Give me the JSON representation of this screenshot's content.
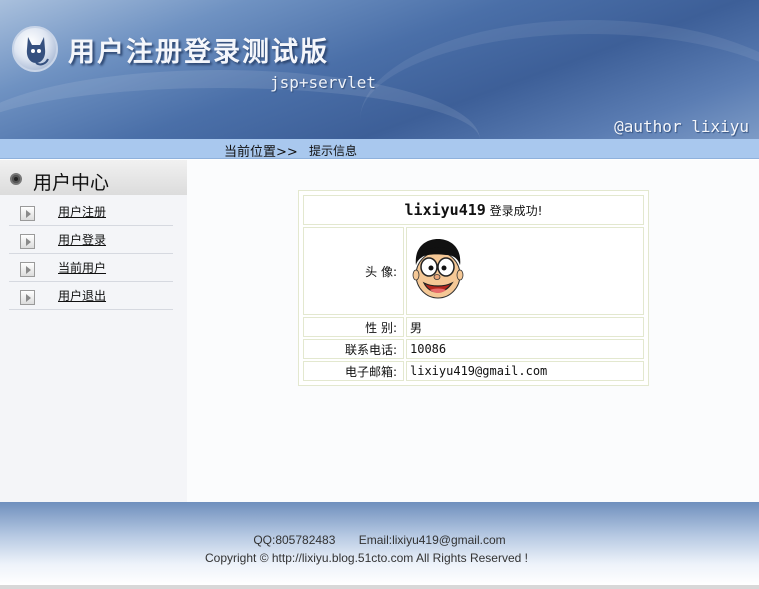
{
  "header": {
    "title": "用户注册登录测试版",
    "subtitle": "jsp+servlet",
    "author": "@author lixiyu"
  },
  "breadcrumb": {
    "label": "当前位置>>",
    "current": "提示信息"
  },
  "sidebar": {
    "title": "用户中心",
    "items": [
      {
        "label": "用户注册"
      },
      {
        "label": "用户登录"
      },
      {
        "label": "当前用户"
      },
      {
        "label": "用户退出"
      }
    ]
  },
  "profile": {
    "username": "lixiyu419",
    "success_msg": "登录成功!",
    "avatar_label": "头 像:",
    "gender_label": "性 别:",
    "gender_value": "男",
    "phone_label": "联系电话:",
    "phone_value": "10086",
    "email_label": "电子邮箱:",
    "email_value": "lixiyu419@gmail.com"
  },
  "footer": {
    "qq": "QQ:805782483",
    "email": "Email:lixiyu419@gmail.com",
    "copyright": "Copyright © http://lixiyu.blog.51cto.com  All Rights Reserved !"
  },
  "colors": {
    "header_blue": "#4a6fa8",
    "breadcrumb_bar": "#a9c8ee",
    "table_border": "#e3e8cf"
  }
}
